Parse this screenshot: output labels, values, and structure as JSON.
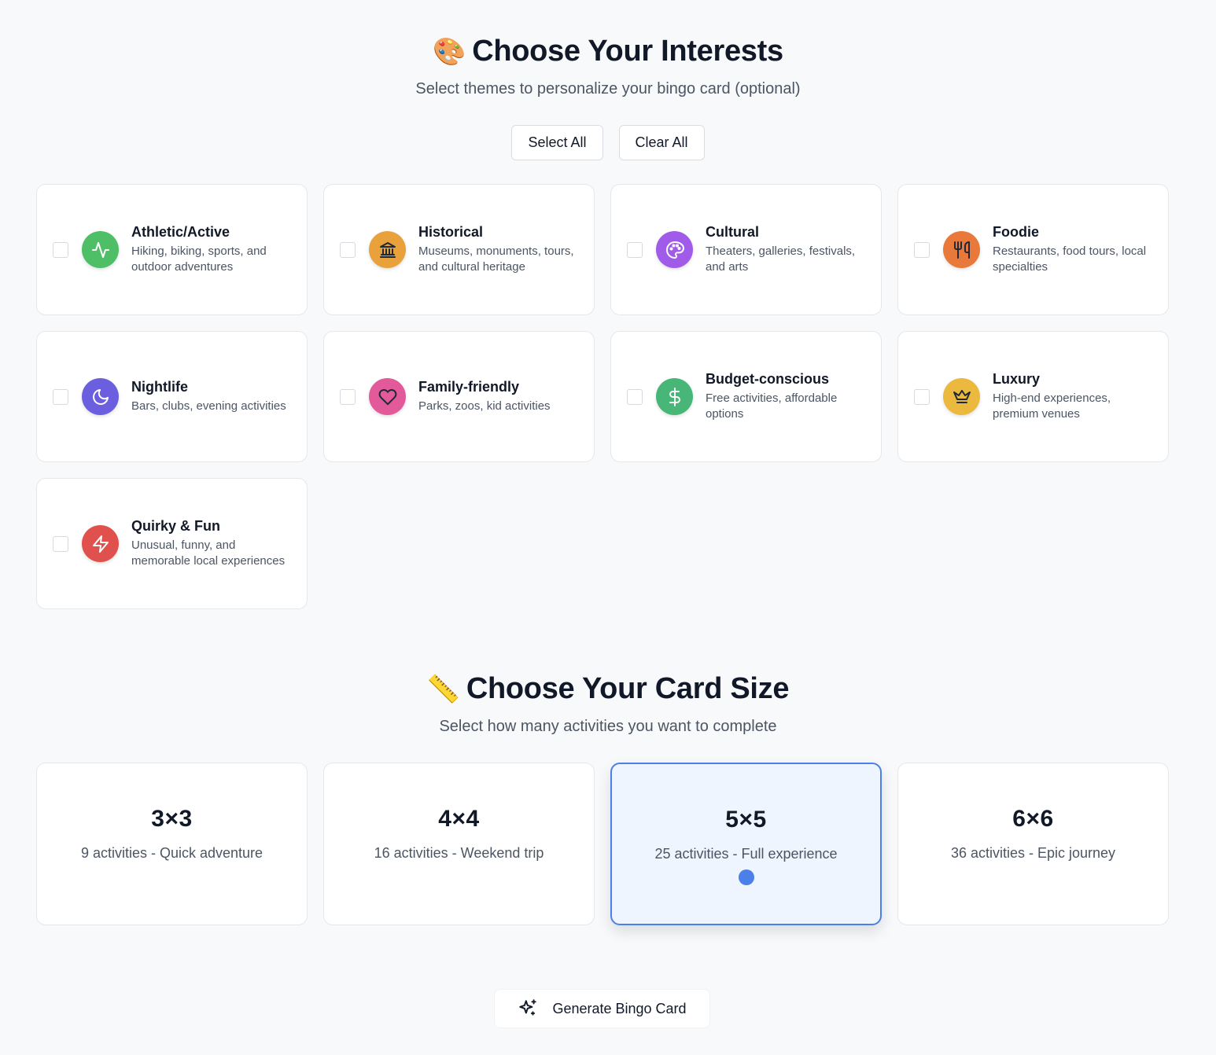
{
  "interests": {
    "emoji": "🎨",
    "title": "Choose Your Interests",
    "subtitle": "Select themes to personalize your bingo card (optional)",
    "select_all_label": "Select All",
    "clear_all_label": "Clear All",
    "items": [
      {
        "title": "Athletic/Active",
        "description": "Hiking, biking, sports, and outdoor adventures",
        "icon": "activity-icon",
        "color": "#4fbf67",
        "checked": false
      },
      {
        "title": "Historical",
        "description": "Museums, monuments, tours, and cultural heritage",
        "icon": "landmark-icon",
        "color": "#e9a23b",
        "checked": false
      },
      {
        "title": "Cultural",
        "description": "Theaters, galleries, festivals, and arts",
        "icon": "palette-icon",
        "color": "#a05be8",
        "checked": false
      },
      {
        "title": "Foodie",
        "description": "Restaurants, food tours, local specialties",
        "icon": "utensils-icon",
        "color": "#e9793b",
        "checked": false
      },
      {
        "title": "Nightlife",
        "description": "Bars, clubs, evening activities",
        "icon": "moon-icon",
        "color": "#6b5fe0",
        "checked": false
      },
      {
        "title": "Family-friendly",
        "description": "Parks, zoos, kid activities",
        "icon": "heart-icon",
        "color": "#e35a9a",
        "checked": false
      },
      {
        "title": "Budget-conscious",
        "description": "Free activities, affordable options",
        "icon": "dollar-icon",
        "color": "#48b676",
        "checked": false
      },
      {
        "title": "Luxury",
        "description": "High-end experiences, premium venues",
        "icon": "crown-icon",
        "color": "#eab93e",
        "checked": false
      },
      {
        "title": "Quirky & Fun",
        "description": "Unusual, funny, and memorable local experiences",
        "icon": "zap-icon",
        "color": "#e0514d",
        "checked": false
      }
    ]
  },
  "card_size": {
    "emoji": "📏",
    "title": "Choose Your Card Size",
    "subtitle": "Select how many activities you want to complete",
    "options": [
      {
        "label": "3×3",
        "description": "9 activities - Quick adventure",
        "selected": false
      },
      {
        "label": "4×4",
        "description": "16 activities - Weekend trip",
        "selected": false
      },
      {
        "label": "5×5",
        "description": "25 activities - Full experience",
        "selected": true
      },
      {
        "label": "6×6",
        "description": "36 activities - Epic journey",
        "selected": false
      }
    ],
    "selected_color": "#4a80e8"
  },
  "generate": {
    "label": "Generate Bingo Card",
    "icon": "sparkles-icon"
  }
}
